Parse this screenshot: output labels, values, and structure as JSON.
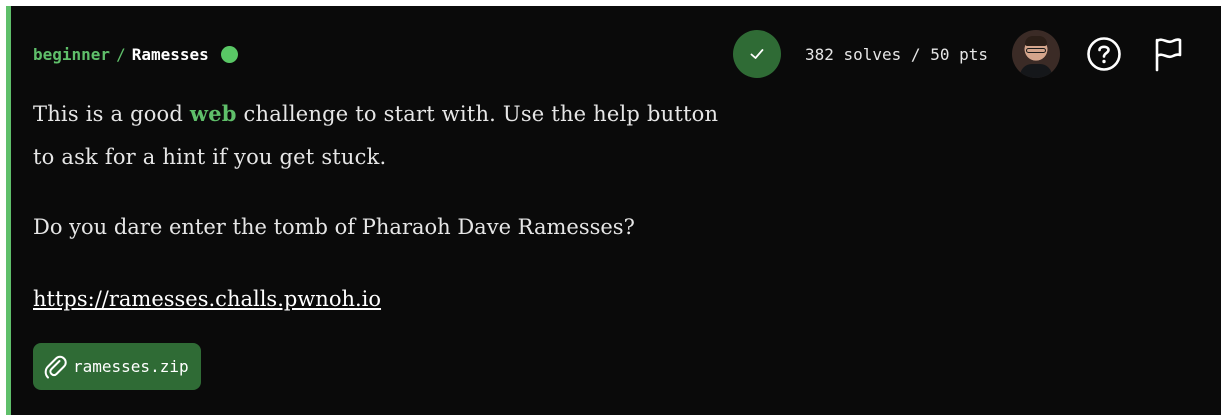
{
  "header": {
    "category": "beginner",
    "separator": "/",
    "name": "Ramesses",
    "status_color": "#59c765"
  },
  "toolbar": {
    "solved_icon": "check-icon",
    "solves_text": "382 solves / 50 pts",
    "avatar_icon": "author-avatar",
    "help_icon": "help-circle-icon",
    "flag_icon": "flag-icon"
  },
  "description": {
    "line1_before": "This is a good ",
    "line1_keyword": "web",
    "line1_after": " challenge to start with. Use the help button",
    "line2": "to ask for a hint if you get stuck.",
    "paragraph2": "Do you dare enter the tomb of Pharaoh Dave Ramesses?",
    "link": "https://ramesses.challs.pwnoh.io"
  },
  "attachment": {
    "icon": "paperclip-icon",
    "filename": "ramesses.zip"
  },
  "colors": {
    "accent": "#5fbf6a",
    "button_green": "#2f6b35",
    "background": "#0a0a0a"
  }
}
